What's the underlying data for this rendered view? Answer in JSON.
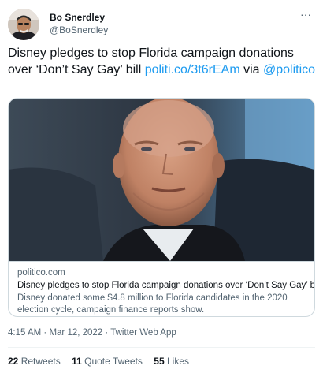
{
  "author": {
    "display_name": "Bo Snerdley",
    "handle": "@BoSnerdley",
    "more_icon": "more-horizontal-icon"
  },
  "tweet": {
    "text_plain": "Disney pledges to stop Florida campaign donations over ‘Don’t Say Gay’ bill ",
    "link": "politi.co/3t6rEAm",
    "text_via": " via ",
    "mention": "@politico"
  },
  "card": {
    "domain": "politico.com",
    "title": "Disney pledges to stop Florida campaign donations over ‘Don’t Say Gay’ bill",
    "description": "Disney donated some $4.8 million to Florida candidates in the 2020 election cycle, campaign finance reports show."
  },
  "meta": {
    "time": "4:15 AM",
    "separator": " · ",
    "date": "Mar 12, 2022",
    "source": "Twitter Web App"
  },
  "stats": {
    "retweets_count": "22",
    "retweets_label": "Retweets",
    "quotes_count": "11",
    "quotes_label": "Quote Tweets",
    "likes_count": "55",
    "likes_label": "Likes"
  },
  "colors": {
    "link": "#1d9bf0",
    "text": "#0f1419",
    "secondary": "#536471",
    "border": "#cfd9de"
  }
}
